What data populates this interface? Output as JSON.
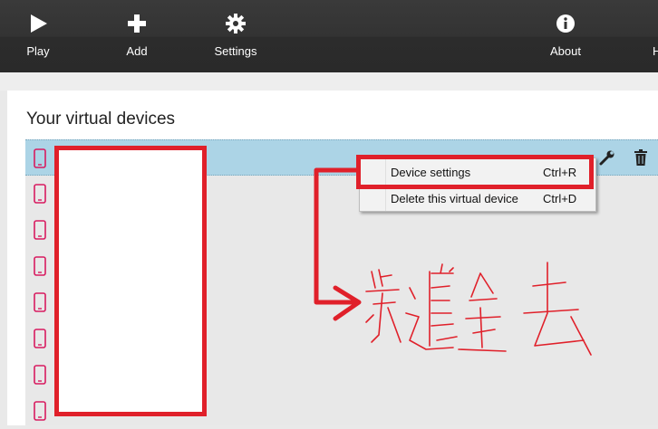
{
  "toolbar": {
    "play_label": "Play",
    "add_label": "Add",
    "settings_label": "Settings",
    "about_label": "About",
    "help_label": "H"
  },
  "page": {
    "title": "Your virtual devices"
  },
  "device_rows": [
    {
      "icon": "phone-icon",
      "label": ""
    },
    {
      "icon": "phone-icon",
      "label": ""
    },
    {
      "icon": "phone-icon",
      "label": ""
    },
    {
      "icon": "phone-icon",
      "label": ""
    },
    {
      "icon": "phone-icon",
      "label": ""
    },
    {
      "icon": "phone-icon",
      "label": ""
    },
    {
      "icon": "phone-icon",
      "label": ""
    },
    {
      "icon": "phone-icon",
      "label": ""
    }
  ],
  "row_tools": {
    "edit_icon": "wrench-icon",
    "delete_icon": "trash-icon"
  },
  "context_menu": {
    "items": [
      {
        "label": "Device settings",
        "shortcut": "Ctrl+R"
      },
      {
        "label": "Delete this virtual device",
        "shortcut": "Ctrl+D"
      }
    ]
  },
  "colors": {
    "toolbar_bg": "#2f2f2f",
    "selected_row": "#acd4e6",
    "annotation_red": "#e0202a",
    "device_icon": "#d81b60"
  }
}
